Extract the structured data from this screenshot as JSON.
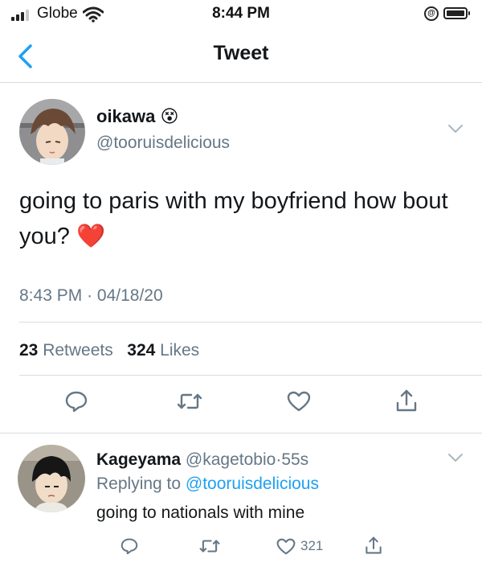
{
  "status_bar": {
    "carrier": "Globe",
    "time": "8:44 PM",
    "rotation_lock_glyph": "@"
  },
  "header": {
    "title": "Tweet",
    "back_icon": "chevron-left-icon"
  },
  "tweet": {
    "display_name": "oikawa",
    "emoji": "😵",
    "handle": "@tooruisdelicious",
    "text": "going to paris with my boyfriend how bout you?",
    "text_emoji": "❤️",
    "time": "8:43 PM",
    "date": "04/18/20",
    "separator": "·",
    "retweets_count": "23",
    "retweets_label": "Retweets",
    "likes_count": "324",
    "likes_label": "Likes"
  },
  "reply": {
    "display_name": "Kageyama",
    "handle": "@kagetobio",
    "separator": "·",
    "age": "55s",
    "replying_to_label": "Replying to",
    "replying_to_handle": "@tooruisdelicious",
    "text": "going to nationals with mine",
    "likes_count": "321"
  },
  "colors": {
    "accent": "#1da1f2",
    "heart": "#e0245e",
    "secondary_text": "#657786",
    "divider": "#d7dce0"
  }
}
